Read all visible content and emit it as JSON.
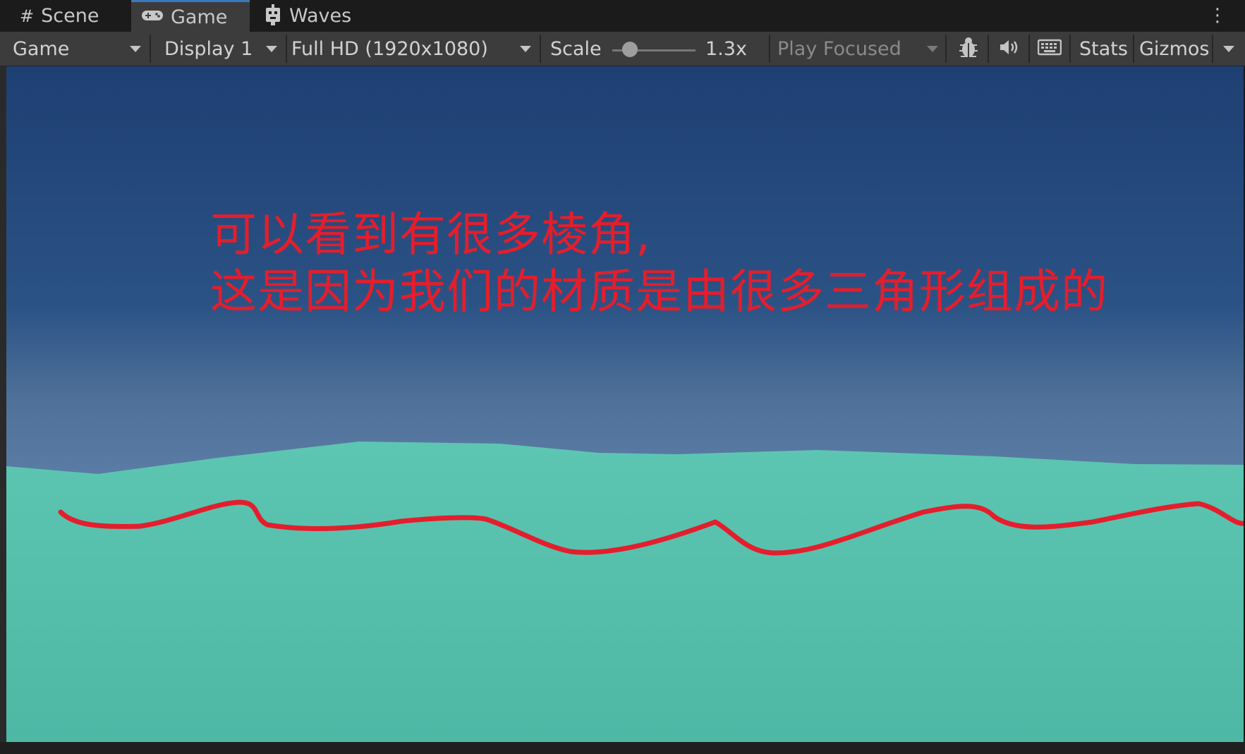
{
  "tabs": [
    {
      "label": "Scene",
      "icon": "grid-icon"
    },
    {
      "label": "Game",
      "icon": "gamepad-icon"
    },
    {
      "label": "Waves",
      "icon": "robot-icon"
    }
  ],
  "toolbar": {
    "game_view": "Game",
    "display": "Display 1",
    "resolution": "Full HD (1920x1080)",
    "scale_label": "Scale",
    "scale_value": "1.3x",
    "play_mode": "Play Focused",
    "stats": "Stats",
    "gizmos": "Gizmos"
  },
  "annotation": {
    "line1": "可以看到有很多棱角,",
    "line2": "这是因为我们的材质是由很多三角形组成的"
  },
  "colors": {
    "sky_top": "#1e3f72",
    "sky_horizon": "#5a7ca4",
    "water": "#56c2ae",
    "annotation": "#e41e2c",
    "active_tab_accent": "#3a79bb"
  }
}
